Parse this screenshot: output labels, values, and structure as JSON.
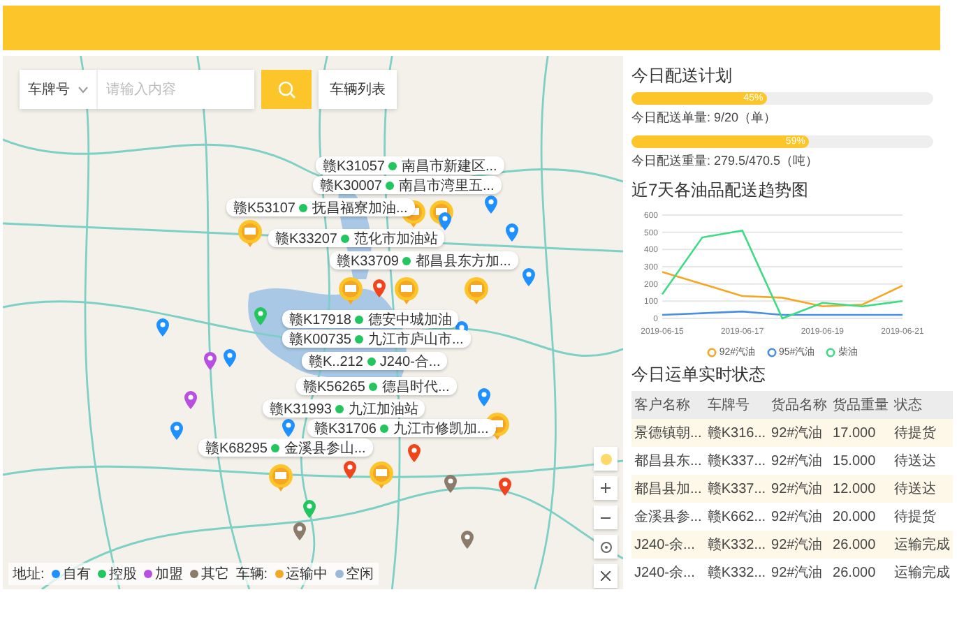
{
  "search": {
    "field_type": "车牌号",
    "placeholder": "请输入内容",
    "list_button": "车辆列表"
  },
  "vehicle_labels": [
    {
      "plate": "赣K31057",
      "place": "南昌市新建区...",
      "color": "#22c55e"
    },
    {
      "plate": "赣K30007",
      "place": "南昌市湾里五...",
      "color": "#22c55e"
    },
    {
      "plate": "赣K53107",
      "place": "抚昌福寮加油...",
      "color": "#22c55e"
    },
    {
      "plate": "赣K33207",
      "place": "范化市加油站",
      "color": "#22c55e"
    },
    {
      "plate": "赣K33709",
      "place": "都昌县东方加...",
      "color": "#22c55e"
    },
    {
      "plate": "赣K17918",
      "place": "德安中城加油",
      "color": "#22c55e"
    },
    {
      "plate": "赣K00735",
      "place": "九江市庐山市...",
      "color": "#22c55e"
    },
    {
      "plate": "赣K..212",
      "place": "J240-合...",
      "color": "#22c55e"
    },
    {
      "plate": "赣K56265",
      "place": "德昌时代...",
      "color": "#22c55e"
    },
    {
      "plate": "赣K31993",
      "place": "九江加油站",
      "color": "#22c55e"
    },
    {
      "plate": "赣K31706",
      "place": "九江市修凯加...",
      "color": "#22c55e"
    },
    {
      "plate": "赣K68295",
      "place": "金溪县参山...",
      "color": "#22c55e"
    }
  ],
  "markers": [
    {
      "kind": "truck"
    },
    {
      "kind": "truck"
    },
    {
      "kind": "truck"
    },
    {
      "kind": "truck"
    },
    {
      "kind": "truck"
    },
    {
      "kind": "truck"
    },
    {
      "kind": "truck"
    },
    {
      "kind": "truck"
    },
    {
      "kind": "truck"
    },
    {
      "kind": "pin",
      "color": "#1e90ff"
    },
    {
      "kind": "pin",
      "color": "#1e90ff"
    },
    {
      "kind": "pin",
      "color": "#1e90ff"
    },
    {
      "kind": "pin",
      "color": "#1e90ff"
    },
    {
      "kind": "pin",
      "color": "#1e90ff"
    },
    {
      "kind": "pin",
      "color": "#1e90ff"
    },
    {
      "kind": "pin",
      "color": "#1e90ff"
    },
    {
      "kind": "pin",
      "color": "#1e90ff"
    },
    {
      "kind": "pin",
      "color": "#1e90ff"
    },
    {
      "kind": "pin",
      "color": "#1e90ff"
    },
    {
      "kind": "pin",
      "color": "#f0441c"
    },
    {
      "kind": "pin",
      "color": "#f0441c"
    },
    {
      "kind": "pin",
      "color": "#f0441c"
    },
    {
      "kind": "pin",
      "color": "#f0441c"
    },
    {
      "kind": "pin",
      "color": "#b84fe0"
    },
    {
      "kind": "pin",
      "color": "#b84fe0"
    },
    {
      "kind": "pin",
      "color": "#8c7b6b"
    },
    {
      "kind": "pin",
      "color": "#8c7b6b"
    },
    {
      "kind": "pin",
      "color": "#8c7b6b"
    },
    {
      "kind": "pin",
      "color": "#22c55e"
    },
    {
      "kind": "pin",
      "color": "#22c55e"
    }
  ],
  "legend": {
    "address_title": "地址:",
    "address_items": [
      {
        "label": "自有",
        "color": "#1e90ff"
      },
      {
        "label": "控股",
        "color": "#22c55e"
      },
      {
        "label": "加盟",
        "color": "#b84fe0"
      },
      {
        "label": "其它",
        "color": "#8c7b6b"
      }
    ],
    "vehicle_title": "车辆:",
    "vehicle_items": [
      {
        "label": "运输中",
        "color": "#f5a623"
      },
      {
        "label": "空闲",
        "color": "#9bb8d8"
      }
    ]
  },
  "plan": {
    "title": "今日配送计划",
    "bars": [
      {
        "level": 0.45,
        "percent": "45%",
        "caption": "今日配送单量: 9/20（单）"
      },
      {
        "level": 0.59,
        "percent": "59%",
        "caption": "今日配送重量: 279.5/470.5（吨）"
      }
    ]
  },
  "trend": {
    "title": "近7天各油品配送趋势图",
    "chart_data": {
      "type": "line",
      "grid": true,
      "categories": [
        "2019-06-15",
        null,
        "2019-06-17",
        null,
        "2019-06-19",
        null,
        "2019-06-21"
      ],
      "ylim": [
        0,
        600
      ],
      "yticks": [
        0,
        100,
        200,
        300,
        400,
        500,
        600
      ],
      "series": [
        {
          "name": "92#汽油",
          "color": "#f5a623",
          "values": [
            270,
            200,
            130,
            120,
            70,
            80,
            190
          ]
        },
        {
          "name": "95#汽油",
          "color": "#4a90e2",
          "values": [
            20,
            30,
            40,
            20,
            20,
            20,
            20
          ]
        },
        {
          "name": "柴油",
          "color": "#3ddc84",
          "values": [
            140,
            470,
            510,
            0,
            90,
            70,
            100
          ]
        }
      ]
    }
  },
  "orders": {
    "title": "今日运单实时状态",
    "columns": [
      "客户名称",
      "车牌号",
      "货品名称",
      "货品重量",
      "状态"
    ],
    "rows": [
      [
        "景德镇朝...",
        "赣K316...",
        "92#汽油",
        "17.000",
        "待提货"
      ],
      [
        "都昌县东...",
        "赣K337...",
        "92#汽油",
        "15.000",
        "待送达"
      ],
      [
        "都昌县加...",
        "赣K337...",
        "92#汽油",
        "12.000",
        "待送达"
      ],
      [
        "金溪县参...",
        "赣K662...",
        "92#汽油",
        "20.000",
        "待提货"
      ],
      [
        "J240-余...",
        "赣K332...",
        "92#汽油",
        "26.000",
        "运输完成"
      ],
      [
        "J240-余...",
        "赣K332...",
        "92#汽油",
        "26.000",
        "运输完成"
      ]
    ]
  }
}
